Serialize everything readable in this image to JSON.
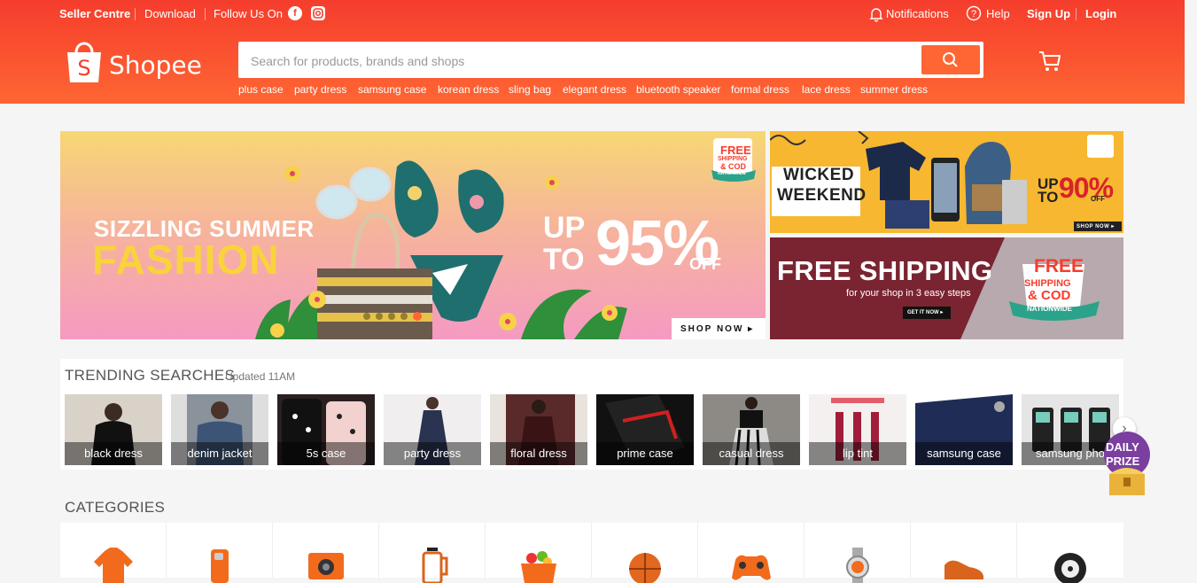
{
  "colors": {
    "brand": "#f53d2d",
    "accent": "#ff6633",
    "background": "#f5f5f5"
  },
  "topnav": {
    "seller_centre": "Seller Centre",
    "download": "Download",
    "follow_us": "Follow Us On",
    "facebook_icon": "facebook-icon",
    "instagram_icon": "instagram-icon",
    "notifications": "Notifications",
    "help": "Help",
    "sign_up": "Sign Up",
    "login": "Login"
  },
  "header": {
    "logo_text": "Shopee",
    "search_placeholder": "Search for products, brands and shops",
    "suggestions": [
      "plus case",
      "party dress",
      "samsung case",
      "korean dress",
      "sling bag",
      "elegant dress",
      "bluetooth speaker",
      "formal dress",
      "lace dress",
      "summer dress"
    ]
  },
  "banners": {
    "main": {
      "line1": "SIZZLING SUMMER",
      "line2": "FASHION",
      "up": "UP",
      "to": "TO",
      "percent": "95%",
      "off": "OFF",
      "badge1": "FREE",
      "badge2": "SHIPPING",
      "badge3": "& COD",
      "badge4": "NATIONWIDE",
      "cta": "SHOP NOW ▸",
      "slides": 5,
      "active_slide": 5
    },
    "sub1": {
      "line1": "WICKED",
      "line2": "WEEKEND",
      "up": "UP",
      "to": "TO",
      "percent": "90%",
      "off": "OFF",
      "cta": "SHOP NOW ▸"
    },
    "sub2": {
      "title": "FREE SHIPPING",
      "subtitle": "for your shop in 3 easy steps",
      "cta": "GET IT NOW ▸",
      "badge1": "FREE",
      "badge2": "SHIPPING",
      "badge3": "& COD",
      "badge4": "NATIONWIDE"
    }
  },
  "trending": {
    "title": "TRENDING SEARCHES",
    "updated": "Updated 11AM",
    "items": [
      {
        "label": "black dress",
        "color": "#d9d2c8"
      },
      {
        "label": "denim jacket",
        "color": "#7f8894"
      },
      {
        "label": "5s case",
        "color": "#2b2020"
      },
      {
        "label": "party dress",
        "color": "#f0eeee"
      },
      {
        "label": "floral dress",
        "color": "#5a2a2a"
      },
      {
        "label": "prime case",
        "color": "#111111"
      },
      {
        "label": "casual dress",
        "color": "#8d8a86"
      },
      {
        "label": "lip tint",
        "color": "#f3f0ef"
      },
      {
        "label": "samsung case",
        "color": "#1f2c55"
      },
      {
        "label": "samsung pho",
        "color": "#e5e5e5"
      }
    ],
    "prize_line1": "DAILY",
    "prize_line2": "PRIZE"
  },
  "categories": {
    "title": "CATEGORIES",
    "items": [
      "shirt-icon",
      "phone-case-icon",
      "camera-icon",
      "coffee-press-icon",
      "grocery-basket-icon",
      "basketball-icon",
      "gamepad-icon",
      "watch-icon",
      "shoe-icon",
      "tire-icon"
    ]
  }
}
